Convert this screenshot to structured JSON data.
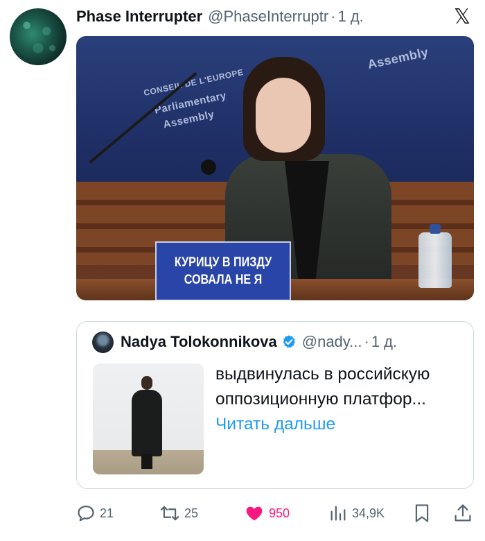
{
  "tweet": {
    "display_name": "Phase Interrupter",
    "handle": "@PhaseInterruptr",
    "separator": "·",
    "time": "1 д.",
    "platform_icon": "x-logo-icon",
    "media": {
      "nameplate_text": "КУРИЦУ В ПИЗДУ СОВАЛА НЕ Я",
      "banner_texts": [
        "CONSEIL DE L'EUROPE",
        "Parliamentary",
        "Assembly",
        "Assembly"
      ]
    }
  },
  "quote": {
    "display_name": "Nadya Tolokonnikova",
    "verified": true,
    "handle": "@nady...",
    "separator": "·",
    "time": "1 д.",
    "text": "выдвинулась в российскую оппозиционную платфор...",
    "read_more": "Читать дальше"
  },
  "actions": {
    "replies": {
      "icon": "reply-icon",
      "count": "21"
    },
    "reposts": {
      "icon": "repost-icon",
      "count": "25"
    },
    "likes": {
      "icon": "heart-icon",
      "count": "950",
      "color": "#f91880"
    },
    "views": {
      "icon": "views-icon",
      "count": "34,9K"
    },
    "bookmark": {
      "icon": "bookmark-icon"
    },
    "share": {
      "icon": "share-icon"
    }
  },
  "colors": {
    "text_primary": "#0f1419",
    "text_secondary": "#536471",
    "link": "#1d9bf0",
    "like": "#f91880",
    "verified": "#1d9bf0",
    "border": "#cfd9de"
  }
}
